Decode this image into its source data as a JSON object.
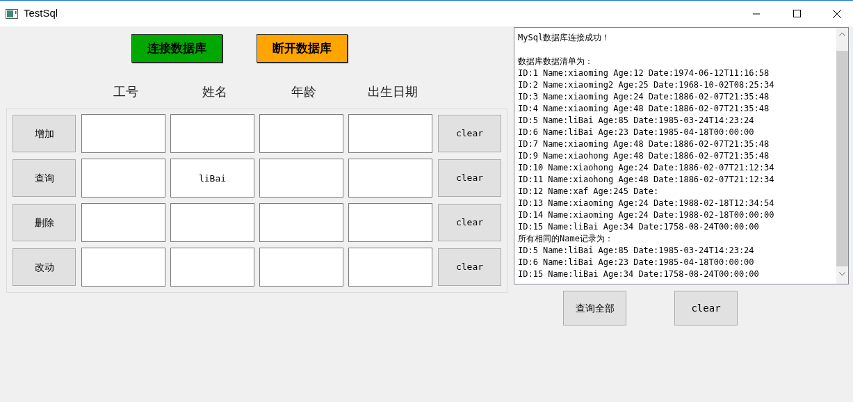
{
  "window": {
    "title": "TestSql"
  },
  "db_buttons": [
    {
      "label": "连接数据库",
      "color": "#00a800"
    },
    {
      "label": "断开数据库",
      "color": "#ffa500"
    }
  ],
  "columns": [
    "工号",
    "姓名",
    "年龄",
    "出生日期"
  ],
  "rows": [
    {
      "action": "增加",
      "clear": "clear"
    },
    {
      "action": "查询",
      "values": {
        "name": "liBai"
      },
      "clear": "clear"
    },
    {
      "action": "删除",
      "clear": "clear"
    },
    {
      "action": "改动",
      "clear": "clear"
    }
  ],
  "log": {
    "paragraphs": [
      [
        "MySql数据库连接成功！"
      ],
      [
        "数据库数据清单为：",
        "ID:1 Name:xiaoming Age:12 Date:1974-06-12T11:16:58",
        "ID:2 Name:xiaoming2 Age:25 Date:1968-10-02T08:25:34",
        "ID:3 Name:xiaoming Age:24 Date:1886-02-07T21:35:48",
        "ID:4 Name:xiaoming Age:48 Date:1886-02-07T21:35:48",
        "ID:5 Name:liBai Age:85 Date:1985-03-24T14:23:24",
        "ID:6 Name:liBai Age:23 Date:1985-04-18T00:00:00",
        "ID:7 Name:xiaoming Age:48 Date:1886-02-07T21:35:48",
        "ID:9 Name:xiaohong Age:48 Date:1886-02-07T21:35:48",
        "ID:10 Name:xiaohong Age:24 Date:1886-02-07T21:12:34",
        "ID:11 Name:xiaohong Age:48 Date:1886-02-07T21:12:34",
        "ID:12 Name:xaf Age:245 Date:",
        "ID:13 Name:xiaoming Age:24 Date:1988-02-18T12:34:54",
        "ID:14 Name:xiaoming Age:24 Date:1988-02-18T00:00:00",
        "ID:15 Name:liBai Age:34 Date:1758-08-24T00:00:00",
        "所有相同的Name记录为：",
        "ID:5 Name:liBai Age:85 Date:1985-03-24T14:23:24",
        "ID:6 Name:liBai Age:23 Date:1985-04-18T00:00:00",
        "ID:15 Name:liBai Age:34 Date:1758-08-24T00:00:00"
      ]
    ]
  },
  "bottom_buttons": [
    "查询全部",
    "clear"
  ]
}
